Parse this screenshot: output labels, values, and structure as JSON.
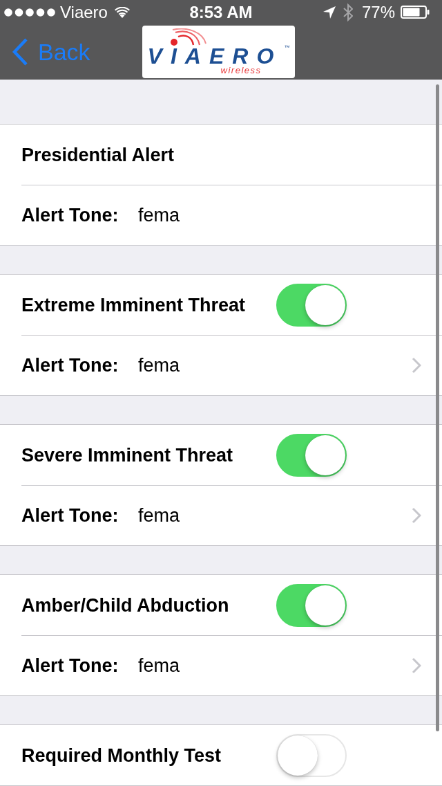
{
  "status_bar": {
    "carrier": "Viaero",
    "time": "8:53 AM",
    "battery_percent": "77%"
  },
  "nav_bar": {
    "back_label": "Back",
    "logo": {
      "wordmark": "VIAERO",
      "trademark": "™",
      "tagline": "wireless"
    }
  },
  "sections": [
    {
      "rows": [
        {
          "kind": "title",
          "label": "Presidential Alert"
        },
        {
          "kind": "tone",
          "label": "Alert Tone:",
          "value": "fema"
        }
      ]
    },
    {
      "rows": [
        {
          "kind": "switch",
          "label": "Extreme Imminent Threat",
          "on": true
        },
        {
          "kind": "tone-link",
          "label": "Alert Tone:",
          "value": "fema"
        }
      ]
    },
    {
      "rows": [
        {
          "kind": "switch",
          "label": "Severe Imminent Threat",
          "on": true
        },
        {
          "kind": "tone-link",
          "label": "Alert Tone:",
          "value": "fema"
        }
      ]
    },
    {
      "rows": [
        {
          "kind": "switch",
          "label": "Amber/Child Abduction",
          "on": true
        },
        {
          "kind": "tone-link",
          "label": "Alert Tone:",
          "value": "fema"
        }
      ]
    },
    {
      "rows": [
        {
          "kind": "switch",
          "label": "Required Monthly Test",
          "on": false
        }
      ]
    }
  ]
}
